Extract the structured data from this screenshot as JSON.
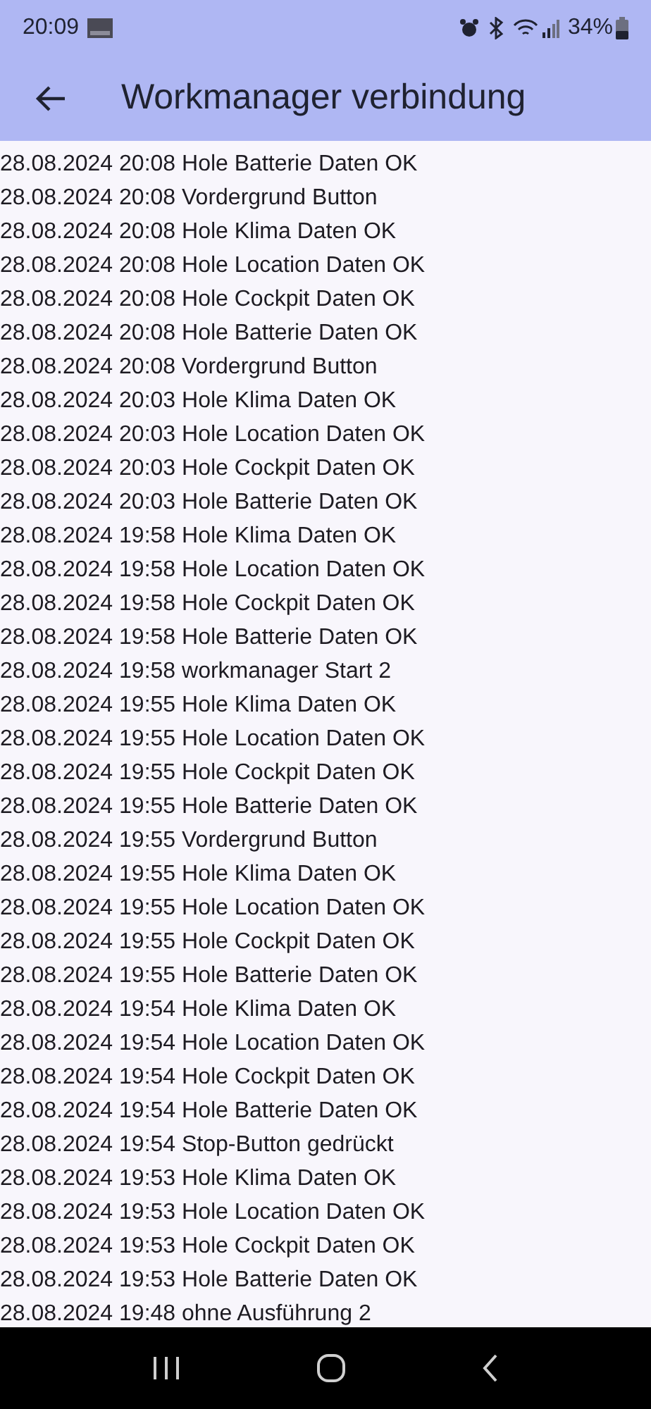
{
  "status_bar": {
    "time": "20:09",
    "battery": "34%"
  },
  "app_bar": {
    "title": "Workmanager verbindung"
  },
  "log_entries": [
    "28.08.2024 20:08 Hole Batterie Daten OK",
    "28.08.2024 20:08 Vordergrund Button",
    "28.08.2024 20:08 Hole Klima Daten OK",
    "28.08.2024 20:08 Hole Location Daten OK",
    "28.08.2024 20:08 Hole Cockpit Daten OK",
    "28.08.2024 20:08 Hole Batterie Daten OK",
    "28.08.2024 20:08 Vordergrund Button",
    "28.08.2024 20:03 Hole Klima Daten OK",
    "28.08.2024 20:03 Hole Location Daten OK",
    "28.08.2024 20:03 Hole Cockpit Daten OK",
    "28.08.2024 20:03 Hole Batterie Daten OK",
    "28.08.2024 19:58 Hole Klima Daten OK",
    "28.08.2024 19:58 Hole Location Daten OK",
    "28.08.2024 19:58 Hole Cockpit Daten OK",
    "28.08.2024 19:58 Hole Batterie Daten OK",
    "28.08.2024 19:58 workmanager Start 2",
    "28.08.2024 19:55 Hole Klima Daten OK",
    "28.08.2024 19:55 Hole Location Daten OK",
    "28.08.2024 19:55 Hole Cockpit Daten OK",
    "28.08.2024 19:55 Hole Batterie Daten OK",
    "28.08.2024 19:55 Vordergrund Button",
    "28.08.2024 19:55 Hole Klima Daten OK",
    "28.08.2024 19:55 Hole Location Daten OK",
    "28.08.2024 19:55 Hole Cockpit Daten OK",
    "28.08.2024 19:55 Hole Batterie Daten OK",
    "28.08.2024 19:54 Hole Klima Daten OK",
    "28.08.2024 19:54 Hole Location Daten OK",
    "28.08.2024 19:54 Hole Cockpit Daten OK",
    "28.08.2024 19:54 Hole Batterie Daten OK",
    "28.08.2024 19:54 Stop-Button gedrückt",
    "28.08.2024 19:53 Hole Klima Daten OK",
    "28.08.2024 19:53 Hole Location Daten OK",
    "28.08.2024 19:53 Hole Cockpit Daten OK",
    "28.08.2024 19:53 Hole Batterie Daten OK",
    "28.08.2024 19:48 ohne Ausführung 2"
  ]
}
